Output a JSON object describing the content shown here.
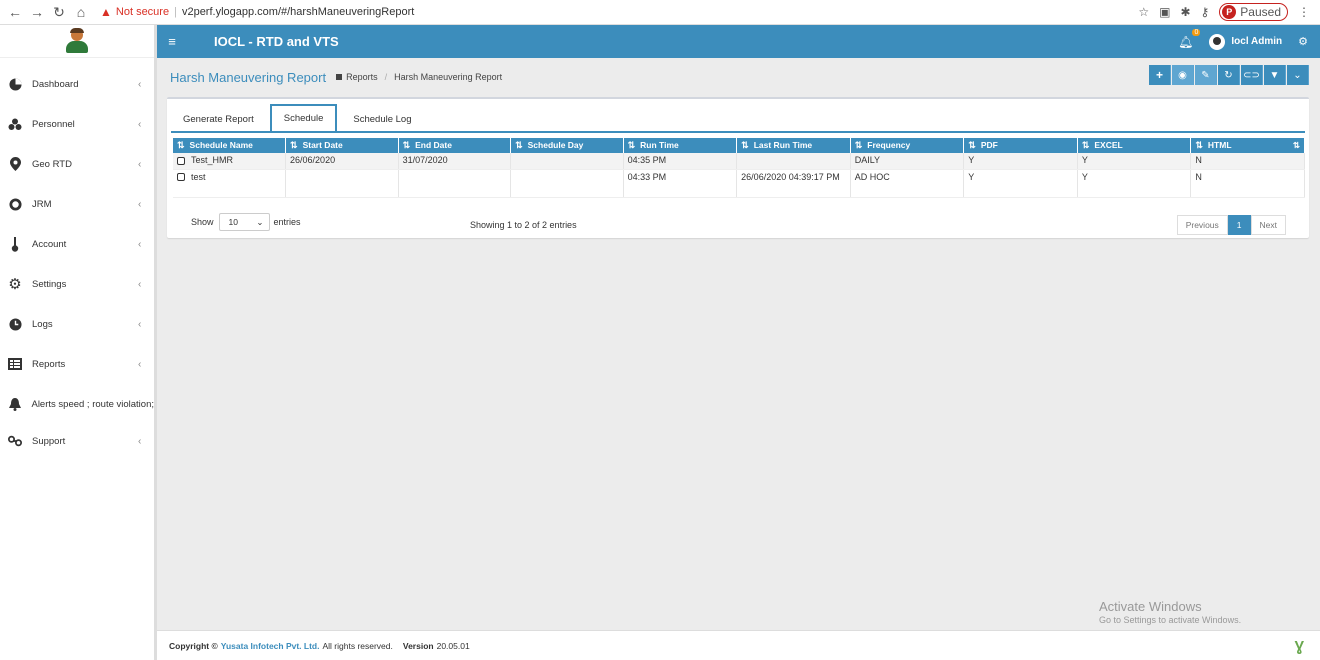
{
  "browser": {
    "not_secure": "Not secure",
    "url": "v2perf.ylogapp.com/#/harshManeuveringReport",
    "profile_initial": "P",
    "profile_status": "Paused"
  },
  "header": {
    "app_title": "IOCL - RTD and VTS",
    "notification_count": "0",
    "user_name": "Iocl Admin"
  },
  "sidebar": {
    "items": [
      {
        "label": "Dashboard",
        "icon": "dashboard-icon"
      },
      {
        "label": "Personnel",
        "icon": "users-icon"
      },
      {
        "label": "Geo RTD",
        "icon": "map-marker-icon"
      },
      {
        "label": "JRM",
        "icon": "life-ring-icon"
      },
      {
        "label": "Account",
        "icon": "thermometer-icon"
      },
      {
        "label": "Settings",
        "icon": "gear-icon"
      },
      {
        "label": "Logs",
        "icon": "clock-icon"
      },
      {
        "label": "Reports",
        "icon": "report-icon"
      },
      {
        "label": "Alerts speed ; route violation;",
        "icon": "bell-icon"
      },
      {
        "label": "Support",
        "icon": "link-icon"
      }
    ]
  },
  "page": {
    "title": "Harsh Maneuvering Report",
    "breadcrumb": [
      "Reports",
      "Harsh Maneuvering Report"
    ]
  },
  "tabs": [
    "Generate Report",
    "Schedule",
    "Schedule Log"
  ],
  "active_tab": "Schedule",
  "table": {
    "columns": [
      "Schedule Name",
      "Start Date",
      "End Date",
      "Schedule Day",
      "Run Time",
      "Last Run Time",
      "Frequency",
      "PDF",
      "EXCEL",
      "HTML"
    ],
    "rows": [
      [
        "Test_HMR",
        "26/06/2020",
        "31/07/2020",
        "",
        "04:35 PM",
        "",
        "DAILY",
        "Y",
        "Y",
        "N"
      ],
      [
        "test",
        "",
        "",
        "",
        "04:33 PM",
        "26/06/2020 04:39:17 PM",
        "AD HOC",
        "Y",
        "Y",
        "N"
      ]
    ]
  },
  "table_footer": {
    "show": "Show",
    "page_size": "10",
    "entries": "entries",
    "info": "Showing 1 to 2 of 2 entries",
    "prev": "Previous",
    "current_page": "1",
    "next": "Next"
  },
  "watermark": {
    "line1": "Activate Windows",
    "line2": "Go to Settings to activate Windows."
  },
  "footer": {
    "copyright": "Copyright ©",
    "company": "Yusata Infotech Pvt. Ltd.",
    "rights": "All rights reserved.",
    "version_label": "Version",
    "version": "20.05.01"
  },
  "colors": {
    "primary": "#3c8dbc",
    "accent_badge": "#f39c12",
    "warning": "#d93025"
  }
}
